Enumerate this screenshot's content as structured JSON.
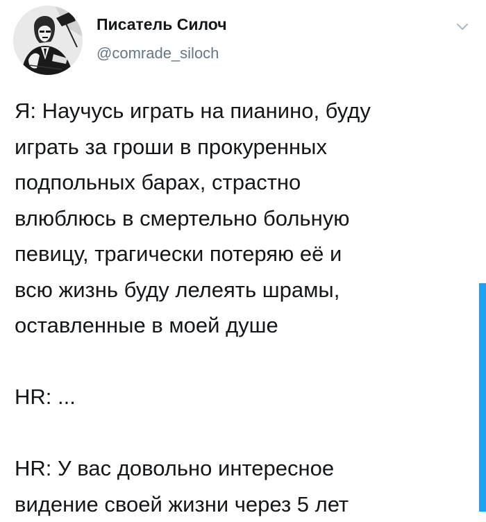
{
  "author": {
    "display_name": "Писатель Силоч",
    "handle": "@comrade_siloch",
    "avatar_icon": "noir-portrait-avatar"
  },
  "menu": {
    "icon": "chevron-down-icon"
  },
  "tweet": {
    "lines": [
      "Я: Научусь играть на пианино, буду",
      "играть за гроши в прокуренных",
      "подпольных барах, страстно",
      "влюблюсь в смертельно больную",
      "певицу, трагически потеряю её и",
      "всю жизнь буду лелеять шрамы,",
      "оставленные в моей душе",
      "",
      "HR: ...",
      "",
      "HR: У вас довольно интересное",
      "видение своей жизни через 5 лет"
    ]
  },
  "colors": {
    "text": "#14171a",
    "secondary": "#657786",
    "accent": "#1da1f2",
    "caret": "#aab8c2"
  }
}
